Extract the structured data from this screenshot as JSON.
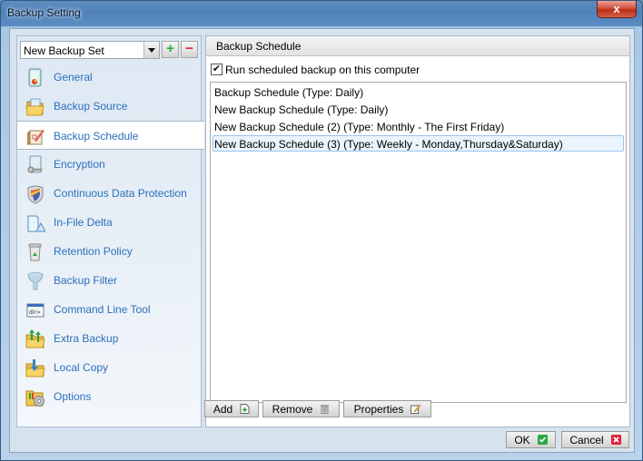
{
  "window": {
    "title": "Backup Setting",
    "close_label": "x"
  },
  "backup_set": {
    "selected": "New Backup Set",
    "add_icon": "plus-icon",
    "remove_icon": "minus-icon"
  },
  "sidebar": {
    "active_index": 2,
    "items": [
      {
        "label": "General",
        "icon": "general-icon"
      },
      {
        "label": "Backup Source",
        "icon": "folder-icon"
      },
      {
        "label": "Backup Schedule",
        "icon": "calendar-pencil-icon"
      },
      {
        "label": "Encryption",
        "icon": "key-document-icon"
      },
      {
        "label": "Continuous Data Protection",
        "icon": "shield-icon"
      },
      {
        "label": "In-File Delta",
        "icon": "delta-icon"
      },
      {
        "label": "Retention Policy",
        "icon": "recycle-bin-icon"
      },
      {
        "label": "Backup Filter",
        "icon": "funnel-icon"
      },
      {
        "label": "Command Line Tool",
        "icon": "command-prompt-icon"
      },
      {
        "label": "Extra Backup",
        "icon": "folder-upload-icon"
      },
      {
        "label": "Local Copy",
        "icon": "folder-copy-icon"
      },
      {
        "label": "Options",
        "icon": "folder-gear-icon"
      }
    ]
  },
  "main": {
    "header": "Backup Schedule",
    "run_checkbox": {
      "label": "Run scheduled backup on this computer",
      "checked": true,
      "mark": "✔"
    },
    "schedules": [
      "Backup Schedule (Type: Daily)",
      "New Backup Schedule (Type: Daily)",
      "New Backup Schedule (2) (Type: Monthly - The First Friday)",
      "New Backup Schedule (3) (Type: Weekly - Monday,Thursday&Saturday)"
    ],
    "selected_schedule_index": 3,
    "buttons": {
      "add": "Add",
      "remove": "Remove",
      "properties": "Properties"
    }
  },
  "footer": {
    "ok": "OK",
    "cancel": "Cancel"
  },
  "colors": {
    "nav_text": "#2a6fbc",
    "ok_green": "#27a844",
    "cancel_red": "#e0243c"
  }
}
